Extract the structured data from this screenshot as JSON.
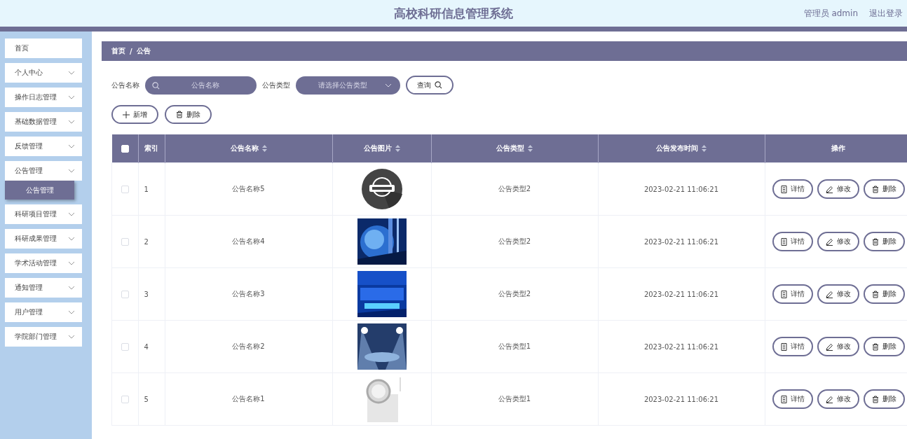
{
  "header": {
    "title": "高校科研信息管理系统",
    "user": "管理员 admin",
    "logout": "退出登录"
  },
  "sidebar": {
    "items": [
      {
        "label": "首页",
        "kind": "link"
      },
      {
        "label": "个人中心",
        "kind": "menu",
        "expanded": false
      },
      {
        "label": "操作日志管理",
        "kind": "menu",
        "expanded": false
      },
      {
        "label": "基础数据管理",
        "kind": "menu",
        "expanded": false
      },
      {
        "label": "反馈管理",
        "kind": "menu",
        "expanded": false
      },
      {
        "label": "公告管理",
        "kind": "menu",
        "expanded": true,
        "children": [
          {
            "label": "公告管理",
            "selected": true
          }
        ]
      },
      {
        "label": "科研项目管理",
        "kind": "menu",
        "expanded": false
      },
      {
        "label": "科研成果管理",
        "kind": "menu",
        "expanded": false
      },
      {
        "label": "学术活动管理",
        "kind": "menu",
        "expanded": false
      },
      {
        "label": "通知管理",
        "kind": "menu",
        "expanded": false
      },
      {
        "label": "用户管理",
        "kind": "menu",
        "expanded": false
      },
      {
        "label": "学院部门管理",
        "kind": "menu",
        "expanded": false
      }
    ]
  },
  "breadcrumb": [
    "首页",
    "公告"
  ],
  "breadcrumb_separator": "/",
  "search": {
    "name_label": "公告名称",
    "name_placeholder": "公告名称",
    "type_label": "公告类型",
    "type_placeholder": "请选择公告类型",
    "query_button": "查询"
  },
  "toolbar": {
    "add_button": "新增",
    "delete_button": "删除"
  },
  "table": {
    "select_all_checked": false,
    "columns": [
      {
        "label": "索引",
        "sortable": false
      },
      {
        "label": "公告名称",
        "sortable": true
      },
      {
        "label": "公告图片",
        "sortable": true
      },
      {
        "label": "公告类型",
        "sortable": true
      },
      {
        "label": "公告发布时间",
        "sortable": true
      },
      {
        "label": "操作",
        "sortable": false
      }
    ],
    "rows": [
      {
        "checked": false,
        "index": "1",
        "name": "公告名称5",
        "type": "公告类型2",
        "time": "2023-02-21 11:06:21",
        "actions": [
          "详情",
          "修改",
          "删除"
        ]
      },
      {
        "checked": false,
        "index": "2",
        "name": "公告名称4",
        "type": "公告类型2",
        "time": "2023-02-21 11:06:21",
        "actions": [
          "详情",
          "修改",
          "删除"
        ]
      },
      {
        "checked": false,
        "index": "3",
        "name": "公告名称3",
        "type": "公告类型2",
        "time": "2023-02-21 11:06:21",
        "actions": [
          "详情",
          "修改",
          "删除"
        ]
      },
      {
        "checked": false,
        "index": "4",
        "name": "公告名称2",
        "type": "公告类型1",
        "time": "2023-02-21 11:06:21",
        "actions": [
          "详情",
          "修改",
          "删除"
        ]
      },
      {
        "checked": false,
        "index": "5",
        "name": "公告名称1",
        "type": "公告类型1",
        "time": "2023-02-21 11:06:21",
        "actions": [
          "详情",
          "修改",
          "删除"
        ]
      }
    ]
  }
}
